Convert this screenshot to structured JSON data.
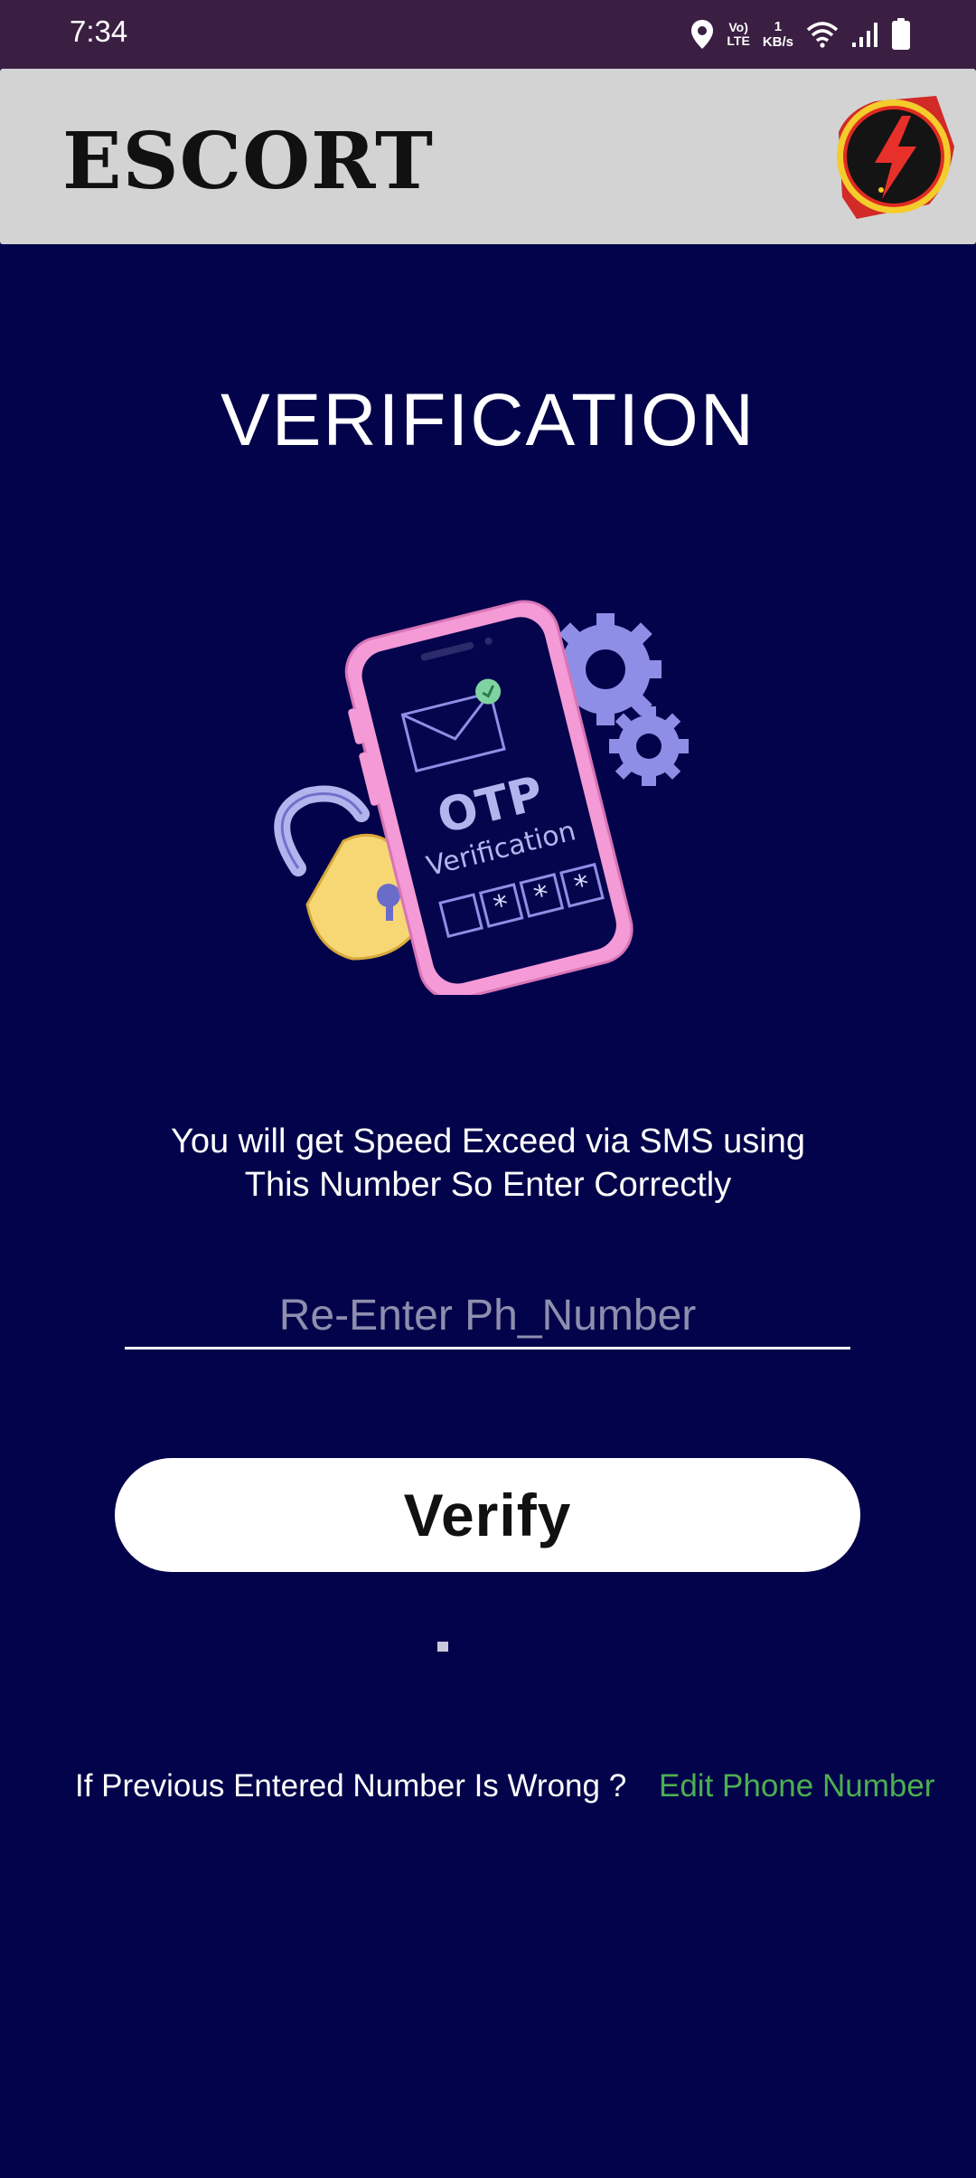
{
  "status_bar": {
    "time": "7:34",
    "network_type": "Vo) LTE",
    "data_speed_value": "1",
    "data_speed_unit": "KB/s",
    "icons": [
      "location-icon",
      "volte-icon",
      "data-speed-icon",
      "wifi-icon",
      "signal-icon",
      "battery-icon"
    ]
  },
  "app_bar": {
    "title": "ESCORT",
    "logo_icon": "lightning-bolt-logo-icon"
  },
  "main": {
    "title": "VERIFICATION",
    "illustration": {
      "heading": "OTP",
      "subheading": "Verification",
      "code_digits": [
        "",
        "*",
        "*",
        "*"
      ]
    },
    "instruction_line1": "You will get Speed Exceed via SMS using",
    "instruction_line2": "This Number So Enter Correctly",
    "phone_input": {
      "value": "",
      "placeholder": "Re-Enter Ph_Number"
    },
    "verify_label": "Verify",
    "footer_prompt": "If Previous Entered Number Is Wrong ?",
    "edit_link_label": "Edit Phone Number"
  },
  "colors": {
    "background": "#03034b",
    "status_bar": "#3a1f42",
    "app_bar": "#d3d3d3",
    "link": "#4caf50",
    "phone_frame": "#f49ad6",
    "gear": "#8f8ee6",
    "lock": "#f7d774"
  }
}
